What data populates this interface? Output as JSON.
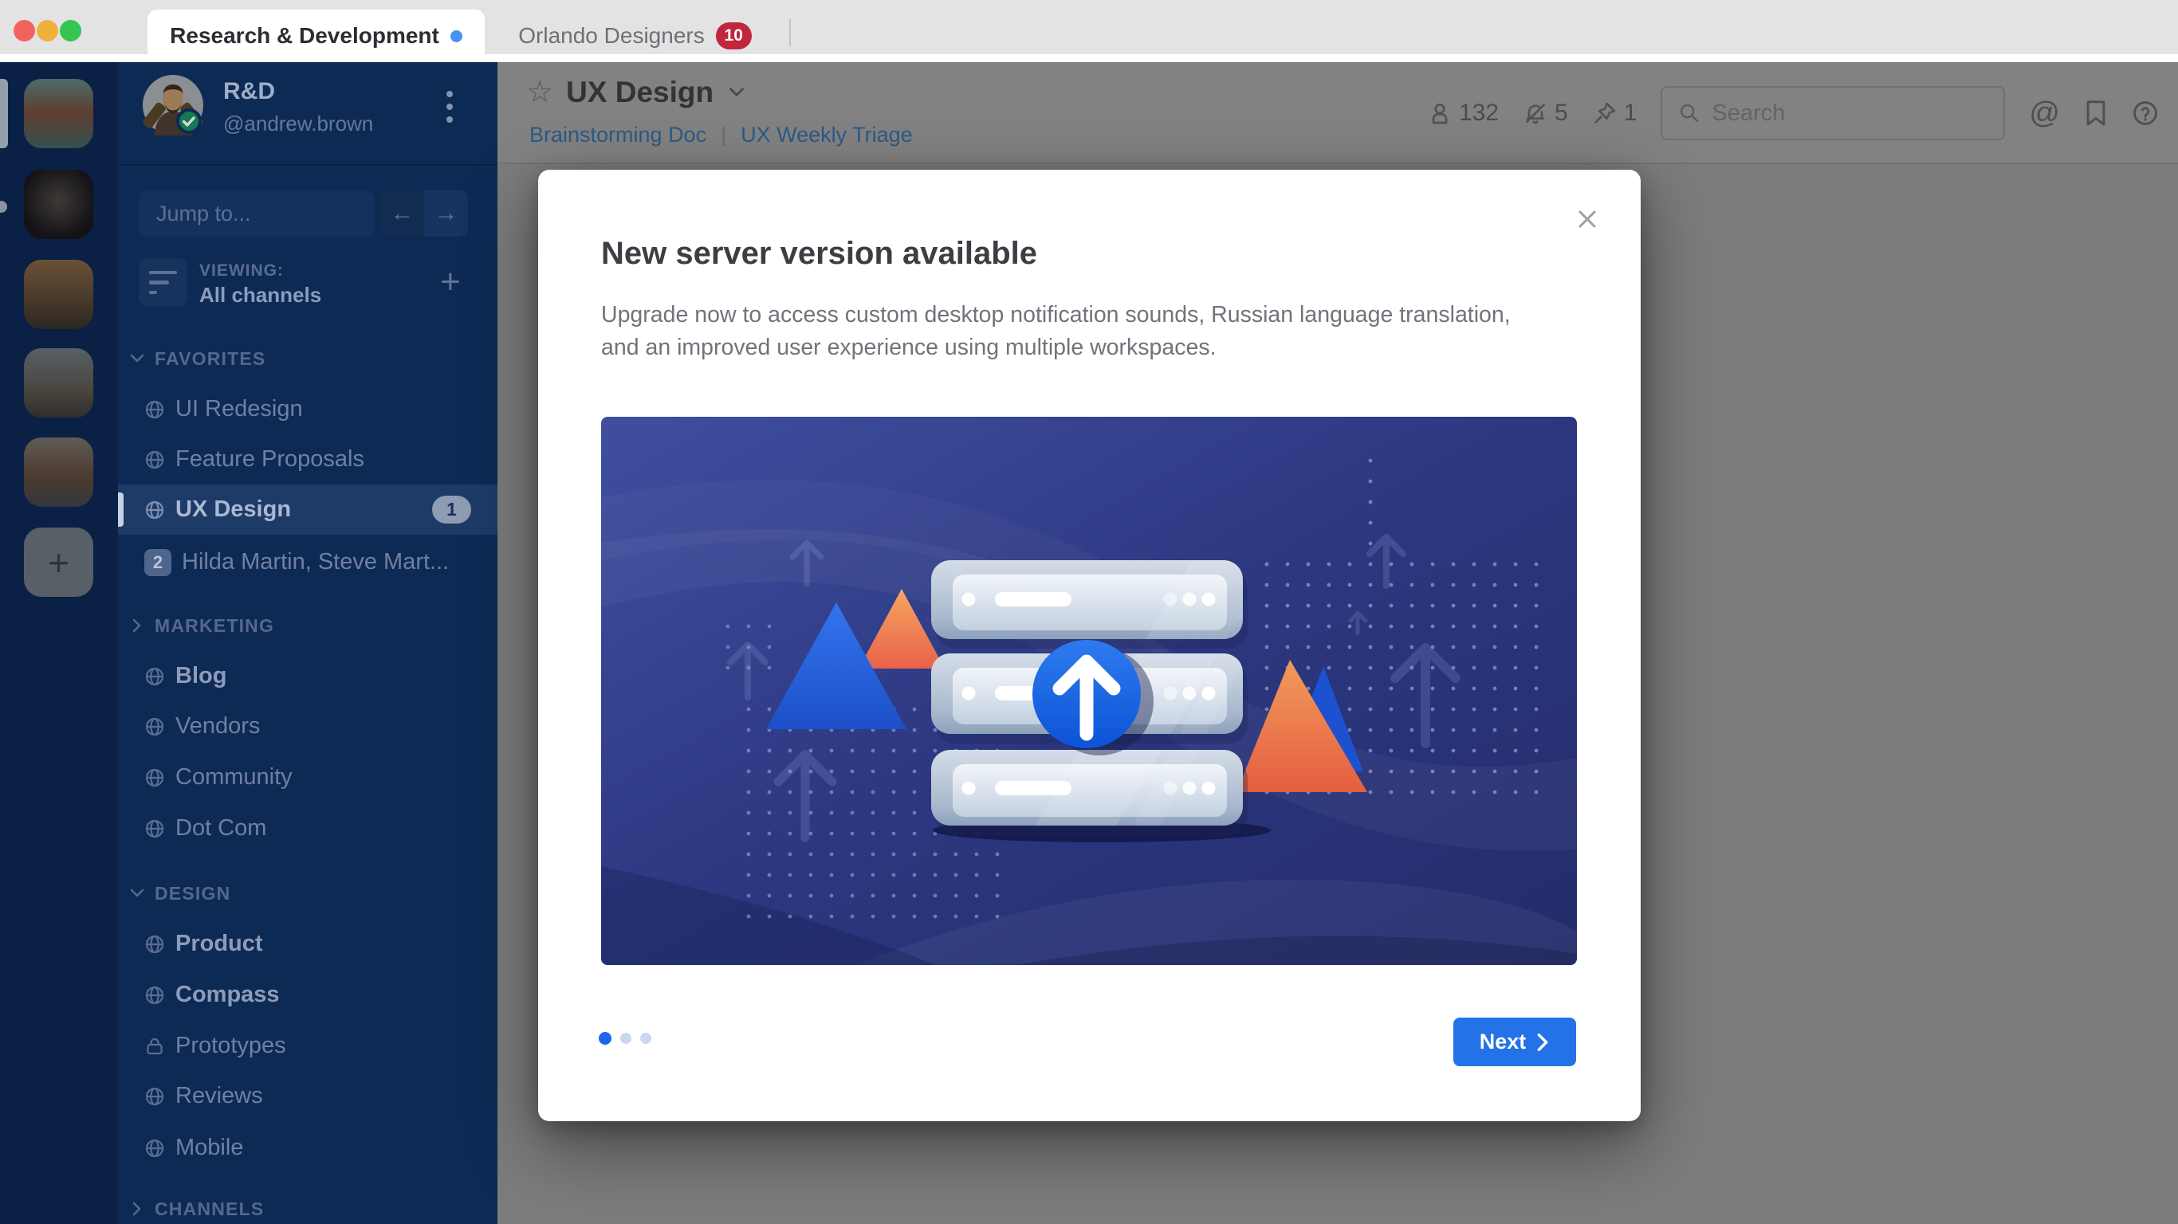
{
  "titlebar": {
    "tabs": [
      {
        "label": "Research & Development",
        "active": true,
        "unread_dot": true
      },
      {
        "label": "Orlando Designers",
        "active": false,
        "badge": "10"
      }
    ]
  },
  "rail": {
    "workspaces": [
      "workspace-photo-1",
      "workspace-photo-2",
      "workspace-photo-3",
      "workspace-photo-4",
      "workspace-photo-5"
    ],
    "add_label": "+"
  },
  "sidebar": {
    "team": "R&D",
    "user": "@andrew.brown",
    "jump_placeholder": "Jump to...",
    "viewing_label": "VIEWING:",
    "viewing_value": "All channels",
    "sections": [
      {
        "label": "FAVORITES",
        "chevron": "down",
        "items": [
          {
            "label": "UI Redesign"
          },
          {
            "label": "Feature Proposals"
          },
          {
            "label": "UX Design",
            "badge": "1",
            "selected": true
          },
          {
            "label": "Hilda Martin, Steve Mart...",
            "count": "2"
          }
        ]
      },
      {
        "label": "MARKETING",
        "chevron": "right",
        "items": [
          {
            "label": "Blog",
            "bold": true,
            "menu": true
          },
          {
            "label": "Vendors"
          },
          {
            "label": "Community"
          },
          {
            "label": "Dot Com"
          }
        ]
      },
      {
        "label": "DESIGN",
        "chevron": "down",
        "items": [
          {
            "label": "Product",
            "bold": true
          },
          {
            "label": "Compass",
            "bold": true
          },
          {
            "label": "Prototypes",
            "locked": true
          },
          {
            "label": "Reviews"
          },
          {
            "label": "Mobile"
          }
        ]
      },
      {
        "label": "CHANNELS",
        "chevron": "right",
        "items": []
      }
    ]
  },
  "header": {
    "title": "UX Design",
    "links": [
      {
        "label": "Brainstorming Doc"
      },
      {
        "label": "UX Weekly Triage"
      }
    ],
    "link_separator": "|",
    "stats": {
      "members": "132",
      "muted": "5",
      "pinned": "1"
    },
    "search_placeholder": "Search"
  },
  "modal": {
    "title": "New server version available",
    "body": "Upgrade now to access custom desktop notification sounds, Russian language translation, and an improved user experience using multiple workspaces.",
    "next_label": "Next",
    "page_count": 3,
    "active_page": 1
  },
  "colors": {
    "sidebar_bg": "#0d2a55",
    "rail_bg": "#0a2145",
    "selected_row_bg": "#1e3a66",
    "accent_blue": "#2372e8",
    "tab_badge_red": "#c0263c",
    "unread_dot_blue": "#4593f2",
    "illustration_bg": "#2c3780"
  }
}
